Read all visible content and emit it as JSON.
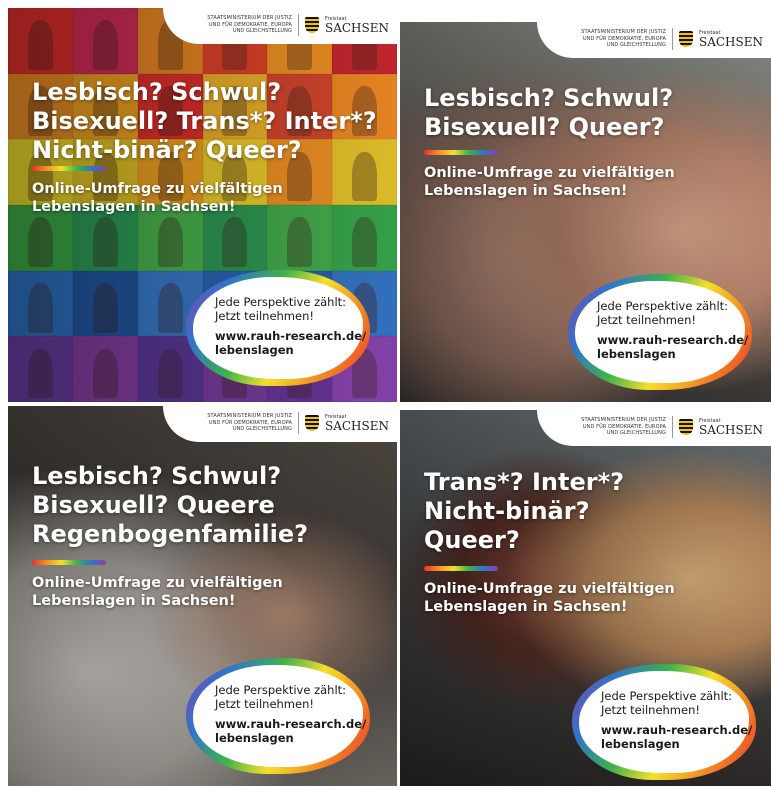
{
  "logo": {
    "ministry": "STAATSMINISTERIUM DER JUSTIZ UND FÜR DEMOKRATIE, EUROPA UND GLEICHSTELLUNG",
    "free_state": "Freistaat",
    "state": "SACHSEN"
  },
  "tiles": [
    {
      "headline": [
        "Lesbisch? Schwul?",
        "Bisexuell? Trans*? Inter*?",
        "Nicht-binär? Queer?"
      ],
      "subline": [
        "Online-Umfrage zu vielfältigen",
        "Lebenslagen in Sachsen!"
      ],
      "cta": [
        "Jede Perspektive zählt:",
        "Jetzt teilnehmen!"
      ],
      "url": [
        "www.rauh-research.de/",
        "lebenslagen"
      ]
    },
    {
      "headline": [
        "Lesbisch? Schwul?",
        "Bisexuell? Queer?"
      ],
      "subline": [
        "Online-Umfrage zu vielfältigen",
        "Lebenslagen in Sachsen!"
      ],
      "cta": [
        "Jede Perspektive zählt:",
        "Jetzt teilnehmen!"
      ],
      "url": [
        "www.rauh-research.de/",
        "lebenslagen"
      ]
    },
    {
      "headline": [
        "Lesbisch? Schwul?",
        "Bisexuell? Queere",
        "Regenbogenfamilie?"
      ],
      "subline": [
        "Online-Umfrage zu vielfältigen",
        "Lebenslagen in Sachsen!"
      ],
      "cta": [
        "Jede Perspektive zählt:",
        "Jetzt teilnehmen!"
      ],
      "url": [
        "www.rauh-research.de/",
        "lebenslagen"
      ]
    },
    {
      "headline": [
        "Trans*? Inter*?",
        "Nicht-binär?",
        "Queer?"
      ],
      "subline": [
        "Online-Umfrage zu vielfältigen",
        "Lebenslagen in Sachsen!"
      ],
      "cta": [
        "Jede Perspektive zählt:",
        "Jetzt teilnehmen!"
      ],
      "url": [
        "www.rauh-research.de/",
        "lebenslagen"
      ]
    }
  ],
  "colors": {
    "rainbow": [
      "#e8302d",
      "#f39324",
      "#f3e02c",
      "#3fb24a",
      "#2f76c9",
      "#8b3fa6"
    ],
    "grid_cells": [
      "#e8302d",
      "#d92d5a",
      "#f08a24",
      "#e5432b",
      "#f39324",
      "#c9272f",
      "#f39324",
      "#f5a623",
      "#e8302d",
      "#f3b52c",
      "#d7472d",
      "#f08a24",
      "#f3e02c",
      "#e9c926",
      "#f5a623",
      "#f3d12c",
      "#f39324",
      "#e8c52a",
      "#3fb24a",
      "#2ea35b",
      "#4cba4f",
      "#2f9e55",
      "#45b04e",
      "#38a84c",
      "#2f76c9",
      "#2359a8",
      "#3b7fd1",
      "#2c67b8",
      "#2a5fb0",
      "#3576c6",
      "#6b3fa6",
      "#8b3fa6",
      "#5e3a9e",
      "#7d3da3",
      "#6a379b",
      "#8a45b0"
    ]
  }
}
